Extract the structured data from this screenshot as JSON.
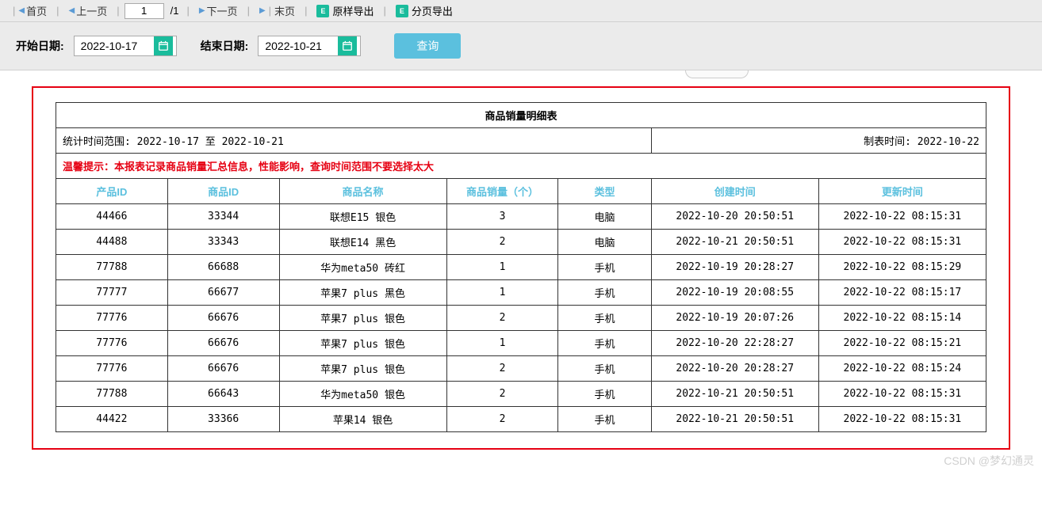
{
  "toolbar": {
    "first": "首页",
    "prev": "上一页",
    "page_value": "1",
    "page_total": "/1",
    "next": "下一页",
    "last": "末页",
    "export_original": "原样导出",
    "export_paged": "分页导出"
  },
  "filters": {
    "start_label": "开始日期:",
    "start_value": "2022-10-17",
    "end_label": "结束日期:",
    "end_value": "2022-10-21",
    "query": "查询"
  },
  "report": {
    "title": "商品销量明细表",
    "range_label": "统计时间范围: 2022-10-17 至 2022-10-21",
    "create_label": "制表时间: 2022-10-22",
    "tip": "温馨提示：本报表记录商品销量汇总信息，性能影响，查询时间范围不要选择太大",
    "columns": [
      "产品ID",
      "商品ID",
      "商品名称",
      "商品销量（个）",
      "类型",
      "创建时间",
      "更新时间"
    ],
    "rows": [
      [
        "44466",
        "33344",
        "联想E15 银色",
        "3",
        "电脑",
        "2022-10-20 20:50:51",
        "2022-10-22 08:15:31"
      ],
      [
        "44488",
        "33343",
        "联想E14 黑色",
        "2",
        "电脑",
        "2022-10-21 20:50:51",
        "2022-10-22 08:15:31"
      ],
      [
        "77788",
        "66688",
        "华为meta50 砖红",
        "1",
        "手机",
        "2022-10-19 20:28:27",
        "2022-10-22 08:15:29"
      ],
      [
        "77777",
        "66677",
        "苹果7 plus 黑色",
        "1",
        "手机",
        "2022-10-19 20:08:55",
        "2022-10-22 08:15:17"
      ],
      [
        "77776",
        "66676",
        "苹果7 plus 银色",
        "2",
        "手机",
        "2022-10-19 20:07:26",
        "2022-10-22 08:15:14"
      ],
      [
        "77776",
        "66676",
        "苹果7 plus 银色",
        "1",
        "手机",
        "2022-10-20 22:28:27",
        "2022-10-22 08:15:21"
      ],
      [
        "77776",
        "66676",
        "苹果7 plus 银色",
        "2",
        "手机",
        "2022-10-20 20:28:27",
        "2022-10-22 08:15:24"
      ],
      [
        "77788",
        "66643",
        "华为meta50 银色",
        "2",
        "手机",
        "2022-10-21 20:50:51",
        "2022-10-22 08:15:31"
      ],
      [
        "44422",
        "33366",
        "苹果14 银色",
        "2",
        "手机",
        "2022-10-21 20:50:51",
        "2022-10-22 08:15:31"
      ]
    ]
  },
  "watermark": "CSDN @梦幻通灵"
}
